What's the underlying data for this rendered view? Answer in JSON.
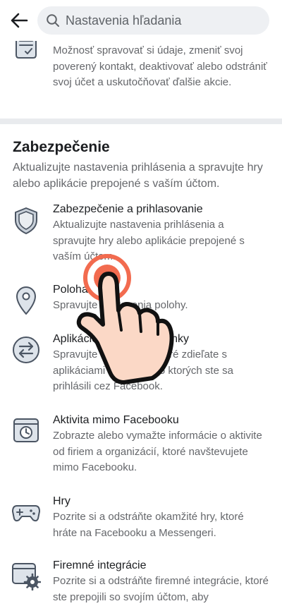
{
  "search": {
    "placeholder": "Nastavenia hľadania",
    "value": ""
  },
  "top_item": {
    "icon": "account-management-icon",
    "desc": "Možnosť spravovať si údaje, zmeniť svoj poverený kontakt, deaktivovať alebo odstrániť svoj účet a uskutočňovať ďalšie akcie."
  },
  "section": {
    "title": "Zabezpečenie",
    "desc": "Aktualizujte nastavenia prihlásenia a spravujte hry alebo aplikácie prepojené s vaším účtom."
  },
  "items": [
    {
      "icon": "shield-icon",
      "title": "Zabezpečenie a prihlasovanie",
      "desc": "Aktualizujte nastavenia prihlásenia a spravujte hry alebo aplikácie prepojené s vaším účtom."
    },
    {
      "icon": "location-pin-icon",
      "title": "Poloha",
      "desc": "Spravujte nastavenia polohy."
    },
    {
      "icon": "swap-arrows-icon",
      "title": "Aplikácie a webové stránky",
      "desc": "Spravujte informácie, ktoré zdieľate s aplikáciami a webmi, do ktorých ste sa prihlásili cez Facebook."
    },
    {
      "icon": "history-browser-icon",
      "title": "Aktivita mimo Facebooku",
      "desc": "Zobrazte alebo vymažte informácie o aktivite od firiem a organizácií, ktoré navštevujete mimo Facebooku."
    },
    {
      "icon": "gamepad-icon",
      "title": "Hry",
      "desc": "Pozrite si a odstráňte okamžité hry, ktoré hráte na Facebooku a Messengeri."
    },
    {
      "icon": "business-integration-icon",
      "title": "Firemné integrácie",
      "desc": "Pozrite si a odstráňte firemné integrácie, ktoré ste prepojili so svojím účtom, aby"
    }
  ],
  "colors": {
    "text": "#1c1e21",
    "secondary": "#65676b",
    "icon_fill": "#dde3ea",
    "icon_stroke": "#4b5563",
    "tap_ring": "#f26b4f",
    "hand": "#fbd8c6"
  }
}
